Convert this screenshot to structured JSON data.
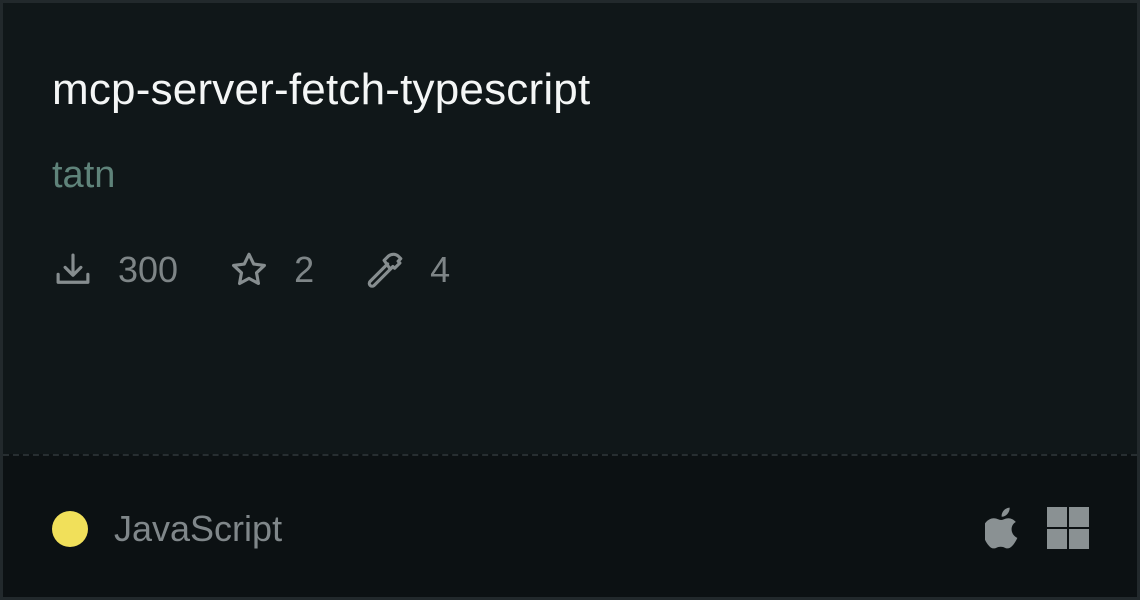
{
  "card": {
    "title": "mcp-server-fetch-typescript",
    "author": "tatn",
    "stats": [
      {
        "icon": "download-icon",
        "value": "300"
      },
      {
        "icon": "star-icon",
        "value": "2"
      },
      {
        "icon": "hammer-icon",
        "value": "4"
      }
    ],
    "language": {
      "name": "JavaScript",
      "color": "#f1e05a"
    },
    "platforms": [
      "apple-icon",
      "windows-icon"
    ]
  }
}
